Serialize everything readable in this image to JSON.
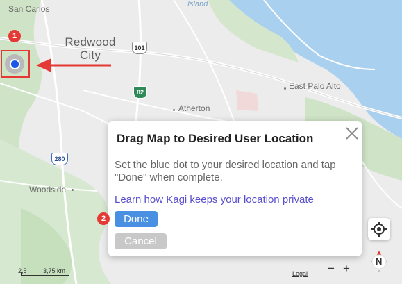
{
  "map": {
    "places": {
      "san_carlos": "San Carlos",
      "island": "Island",
      "redwood_city_line1": "Redwood",
      "redwood_city_line2": "City",
      "east_palo_alto": "East Palo Alto",
      "atherton": "Atherton",
      "woodside": "Woodside"
    },
    "shields": {
      "us101": "101",
      "ca82": "82",
      "i280": "280"
    },
    "scale": {
      "left_label": "2,5",
      "right_label": "3,75 km"
    },
    "legal_label": "Legal",
    "zoom_out_label": "−",
    "zoom_in_label": "+",
    "compass_label": "N"
  },
  "annotations": {
    "badge1": "1",
    "badge2": "2"
  },
  "dialog": {
    "title": "Drag Map to Desired User Location",
    "description": "Set the blue dot to your desired location and tap \"Done\" when complete.",
    "link": "Learn how Kagi keeps your location private",
    "done_label": "Done",
    "cancel_label": "Cancel"
  },
  "colors": {
    "accent_blue": "#4a90e2",
    "annotation_red": "#e53935",
    "link_purple": "#5a4fcf",
    "user_dot": "#1a57e8"
  }
}
